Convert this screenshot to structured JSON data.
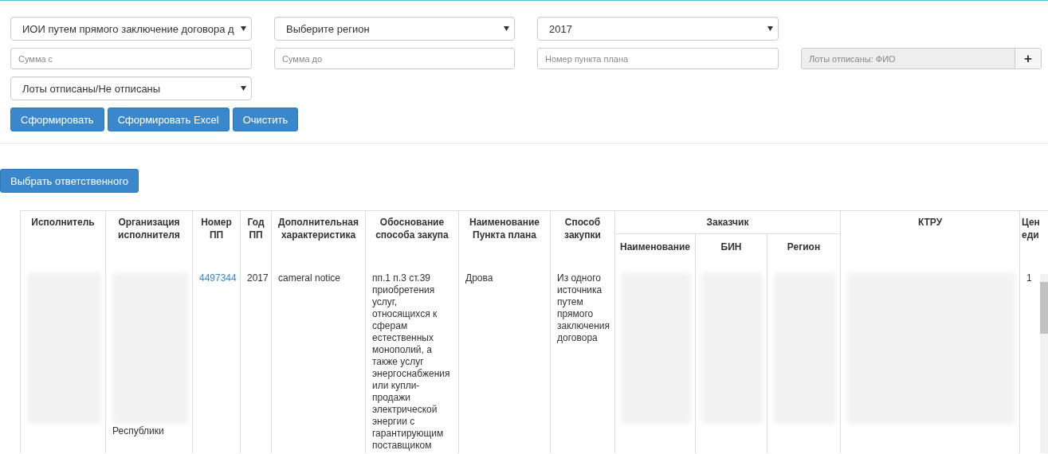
{
  "filters": {
    "selects": [
      {
        "value": "ИОИ путем прямого заключение договора д"
      },
      {
        "value": "Выберите регион"
      },
      {
        "value": "2017"
      }
    ],
    "inputs": [
      {
        "placeholder": "Сумма с"
      },
      {
        "placeholder": "Сумма до"
      },
      {
        "placeholder": "Номер пункта плана"
      }
    ],
    "assignee_field": {
      "placeholder": "Лоты отписаны: ФИО",
      "disabled": true,
      "button": "+"
    },
    "status_select": {
      "value": "Лоты отписаны/Не отписаны"
    },
    "buttons": [
      "Сформировать",
      "Сформировать Excel",
      "Очистить"
    ]
  },
  "assign_button": "Выбрать ответственного",
  "table": {
    "columns": [
      {
        "label": "Исполнитель"
      },
      {
        "label": "Организация исполнителя"
      },
      {
        "label": "Номер ПП"
      },
      {
        "label": "Год ПП"
      },
      {
        "label": "Дополнительная характеристика"
      },
      {
        "label": "Обоснование способа закупа"
      },
      {
        "label": "Наименование Пункта плана"
      },
      {
        "label": "Способ закупки"
      },
      {
        "label": "Заказчик",
        "children": [
          {
            "label": "Наименование"
          },
          {
            "label": "БИН"
          },
          {
            "label": "Регион"
          }
        ]
      },
      {
        "label": "КТРУ"
      },
      {
        "label": "Цен еди"
      }
    ],
    "rows": [
      {
        "cells": [
          {
            "kind": "redacted"
          },
          {
            "kind": "redacted",
            "tail": "Республики"
          },
          {
            "kind": "link",
            "text": "4497344"
          },
          {
            "kind": "text",
            "text": "2017"
          },
          {
            "kind": "text",
            "text": "cameral notice"
          },
          {
            "kind": "text",
            "text": "пп.1 п.3 ст.39 приобретения услуг, относящихся к сферам естественных монополий, а также услуг энергоснабжения или купли-продажи электрической энергии с гарантирующим поставщиком"
          },
          {
            "kind": "text",
            "text": "Дрова"
          },
          {
            "kind": "text",
            "text": "Из одного источника путем прямого заключения договора"
          },
          {
            "kind": "redacted"
          },
          {
            "kind": "redacted"
          },
          {
            "kind": "redacted"
          },
          {
            "kind": "redacted"
          },
          {
            "kind": "text",
            "text": "1"
          }
        ]
      }
    ]
  }
}
